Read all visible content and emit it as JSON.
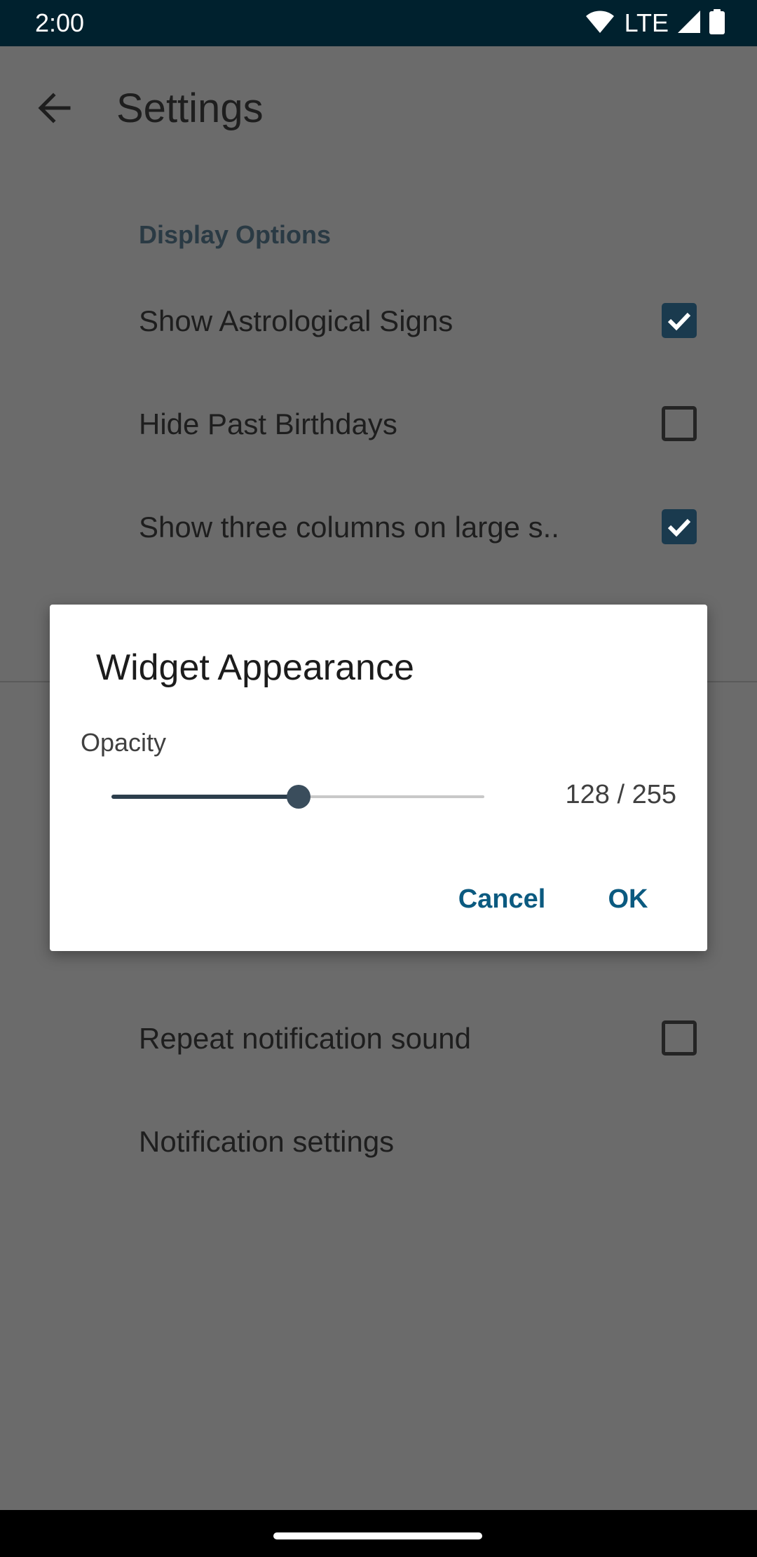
{
  "status_bar": {
    "time": "2:00",
    "network": "LTE",
    "icons": [
      "wifi-icon",
      "cell-signal-icon",
      "battery-icon"
    ]
  },
  "app_bar": {
    "title": "Settings",
    "back_icon": "arrow-back-icon"
  },
  "section": {
    "header": "Display Options"
  },
  "preferences": [
    {
      "label": "Show Astrological Signs",
      "checked": true
    },
    {
      "label": "Hide Past Birthdays",
      "checked": false
    },
    {
      "label": "Show three columns on large s..",
      "checked": true
    },
    {
      "label": "Repeat notification sound",
      "checked": false
    },
    {
      "label": "Notification settings"
    }
  ],
  "dialog": {
    "title": "Widget Appearance",
    "opacity_label": "Opacity",
    "slider": {
      "value": 128,
      "max": 255
    },
    "readout": "128 / 255",
    "cancel_label": "Cancel",
    "ok_label": "OK"
  },
  "colors": {
    "status_bar": "#00212e",
    "scrim_background": "#6b6b6b",
    "accent": "#0b5a80",
    "checkbox_checked": "#1a3a4e"
  }
}
